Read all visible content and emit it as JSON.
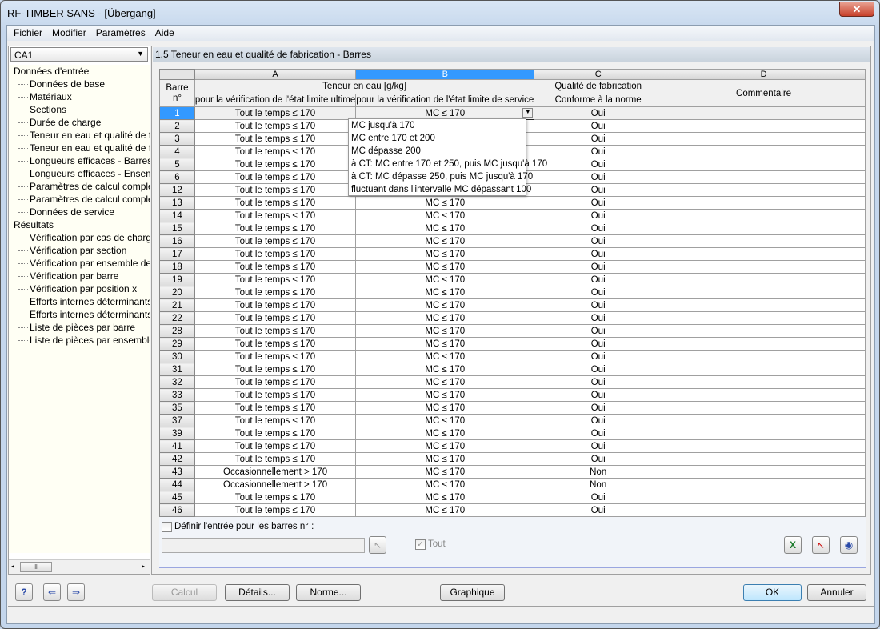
{
  "window": {
    "title": "RF-TIMBER SANS - [Übergang]",
    "close": "✕"
  },
  "menu": [
    "Fichier",
    "Modifier",
    "Paramètres",
    "Aide"
  ],
  "load_case": "CA1",
  "tree": {
    "input_label": "Données d'entrée",
    "input_items": [
      "Données de base",
      "Matériaux",
      "Sections",
      "Durée de charge",
      "Teneur en eau et qualité de fab",
      "Teneur en eau et qualité de fab",
      "Longueurs efficaces - Barres",
      "Longueurs efficaces - Ensemble",
      "Paramètres de calcul compléme",
      "Paramètres de calcul compléme",
      "Données de service"
    ],
    "results_label": "Résultats",
    "result_items": [
      "Vérification par cas de charge",
      "Vérification par section",
      "Vérification par ensemble de ba",
      "Vérification par barre",
      "Vérification par position x",
      "Efforts internes déterminants p",
      "Efforts internes déterminants p",
      "Liste de pièces par barre",
      "Liste de pièces par ensemble de"
    ]
  },
  "section_title": "1.5 Teneur en eau et qualité de fabrication - Barres",
  "table": {
    "col_letters": [
      "A",
      "B",
      "C",
      "D"
    ],
    "barre_header": "Barre n°",
    "group_header": "Teneur en eau [g/kg]",
    "col_a_header": "pour la vérification de l'état limite ultime",
    "col_b_header": "pour la vérification de l'état limite de service",
    "col_c_header1": "Qualité de fabrication",
    "col_c_header2": "Conforme à la norme",
    "col_d_header": "Commentaire",
    "rows": [
      [
        "1",
        "Tout le temps ≤ 170",
        "MC ≤ 170",
        "Oui",
        ""
      ],
      [
        "2",
        "Tout le temps ≤ 170",
        "MC ≤ 170",
        "Oui",
        ""
      ],
      [
        "3",
        "Tout le temps ≤ 170",
        "MC ≤ 170",
        "Oui",
        ""
      ],
      [
        "4",
        "Tout le temps ≤ 170",
        "MC ≤ 170",
        "Oui",
        ""
      ],
      [
        "5",
        "Tout le temps ≤ 170",
        "MC ≤ 170",
        "Oui",
        ""
      ],
      [
        "6",
        "Tout le temps ≤ 170",
        "MC ≤ 170",
        "Oui",
        ""
      ],
      [
        "12",
        "Tout le temps ≤ 170",
        "MC ≤ 170",
        "Oui",
        ""
      ],
      [
        "13",
        "Tout le temps ≤ 170",
        "MC ≤ 170",
        "Oui",
        ""
      ],
      [
        "14",
        "Tout le temps ≤ 170",
        "MC ≤ 170",
        "Oui",
        ""
      ],
      [
        "15",
        "Tout le temps ≤ 170",
        "MC ≤ 170",
        "Oui",
        ""
      ],
      [
        "16",
        "Tout le temps ≤ 170",
        "MC ≤ 170",
        "Oui",
        ""
      ],
      [
        "17",
        "Tout le temps ≤ 170",
        "MC ≤ 170",
        "Oui",
        ""
      ],
      [
        "18",
        "Tout le temps ≤ 170",
        "MC ≤ 170",
        "Oui",
        ""
      ],
      [
        "19",
        "Tout le temps ≤ 170",
        "MC ≤ 170",
        "Oui",
        ""
      ],
      [
        "20",
        "Tout le temps ≤ 170",
        "MC ≤ 170",
        "Oui",
        ""
      ],
      [
        "21",
        "Tout le temps ≤ 170",
        "MC ≤ 170",
        "Oui",
        ""
      ],
      [
        "22",
        "Tout le temps ≤ 170",
        "MC ≤ 170",
        "Oui",
        ""
      ],
      [
        "28",
        "Tout le temps ≤ 170",
        "MC ≤ 170",
        "Oui",
        ""
      ],
      [
        "29",
        "Tout le temps ≤ 170",
        "MC ≤ 170",
        "Oui",
        ""
      ],
      [
        "30",
        "Tout le temps ≤ 170",
        "MC ≤ 170",
        "Oui",
        ""
      ],
      [
        "31",
        "Tout le temps ≤ 170",
        "MC ≤ 170",
        "Oui",
        ""
      ],
      [
        "32",
        "Tout le temps ≤ 170",
        "MC ≤ 170",
        "Oui",
        ""
      ],
      [
        "33",
        "Tout le temps ≤ 170",
        "MC ≤ 170",
        "Oui",
        ""
      ],
      [
        "35",
        "Tout le temps ≤ 170",
        "MC ≤ 170",
        "Oui",
        ""
      ],
      [
        "37",
        "Tout le temps ≤ 170",
        "MC ≤ 170",
        "Oui",
        ""
      ],
      [
        "39",
        "Tout le temps ≤ 170",
        "MC ≤ 170",
        "Oui",
        ""
      ],
      [
        "41",
        "Tout le temps ≤ 170",
        "MC ≤ 170",
        "Oui",
        ""
      ],
      [
        "42",
        "Tout le temps ≤ 170",
        "MC ≤ 170",
        "Oui",
        ""
      ],
      [
        "43",
        "Occasionnellement > 170",
        "MC ≤ 170",
        "Non",
        ""
      ],
      [
        "44",
        "Occasionnellement > 170",
        "MC ≤ 170",
        "Non",
        ""
      ],
      [
        "45",
        "Tout le temps ≤ 170",
        "MC ≤ 170",
        "Oui",
        ""
      ],
      [
        "46",
        "Tout le temps ≤ 170",
        "MC ≤ 170",
        "Oui",
        ""
      ]
    ]
  },
  "dropdown_options": [
    "MC jusqu'à 170",
    "MC entre 170 et 200",
    "MC dépasse 200",
    "à CT: MC entre 170 et 250, puis MC jusqu'à 170",
    "à CT: MC dépasse 250, puis MC jusqu'à 170",
    "fluctuant dans l'intervalle MC dépassant 100"
  ],
  "define_label": "Définir l'entrée pour les barres n° :",
  "define_value": "",
  "all_label": "Tout",
  "buttons": {
    "calc": "Calcul",
    "details": "Détails...",
    "norme": "Norme...",
    "graphique": "Graphique",
    "ok": "OK",
    "annuler": "Annuler"
  },
  "colors": {
    "selection": "#3399ff",
    "panel": "#f1f4f9"
  }
}
